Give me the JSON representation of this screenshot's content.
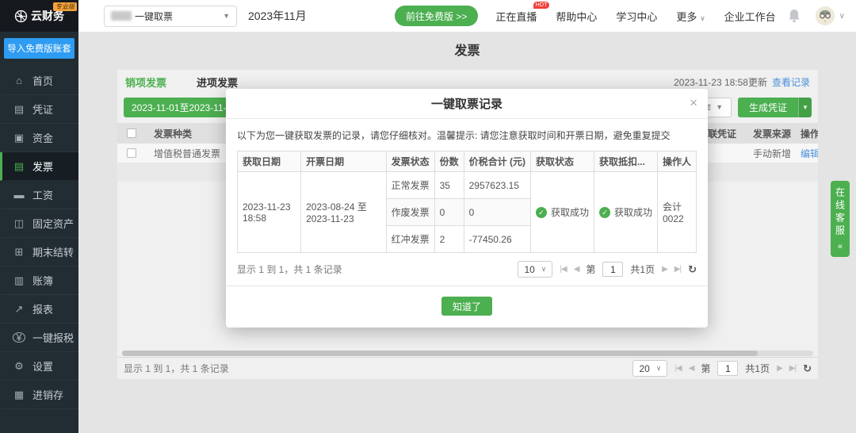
{
  "topbar": {
    "logo_text": "云财务",
    "logo_badge": "专业版",
    "module_select_value": "一键取票",
    "period": "2023年11月",
    "free_version_button": "前往免费版 >>",
    "live": "正在直播",
    "live_badge": "HOT",
    "help_center": "帮助中心",
    "learn_center": "学习中心",
    "more": "更多",
    "workbench": "企业工作台"
  },
  "sidebar": {
    "import_button": "导入免费版账套",
    "items": [
      {
        "icon": "⌂",
        "label": "首页"
      },
      {
        "icon": "▤",
        "label": "凭证"
      },
      {
        "icon": "▣",
        "label": "资金"
      },
      {
        "icon": "▤",
        "label": "发票"
      },
      {
        "icon": "▬",
        "label": "工资"
      },
      {
        "icon": "◫",
        "label": "固定资产"
      },
      {
        "icon": "⊞",
        "label": "期末结转"
      },
      {
        "icon": "▥",
        "label": "账簿"
      },
      {
        "icon": "↗",
        "label": "报表"
      },
      {
        "icon": "¥",
        "label": "一键报税"
      },
      {
        "icon": "⚙",
        "label": "设置"
      },
      {
        "icon": "▦",
        "label": "进销存"
      }
    ]
  },
  "page": {
    "title": "发票",
    "tab_sales": "销项发票",
    "tab_purchase": "进项发票",
    "update_time": "2023-11-23 18:58更新",
    "view_record_link": "查看记录",
    "date_range_button": "2023-11-01至2023-11-30",
    "batch_button": "批量操作",
    "generate_button": "生成凭证",
    "table": {
      "col_type": "发票种类",
      "col_voucher": "关联凭证",
      "col_source": "发票来源",
      "col_action": "操作",
      "row": {
        "type": "增值税普通发票",
        "source": "手动新增",
        "action": "编辑"
      }
    },
    "pagination": {
      "summary": "显示 1 到 1，共 1 条记录",
      "page_size": "20",
      "page_prefix": "第",
      "page": "1",
      "total_pages": "共1页"
    }
  },
  "modal": {
    "title": "一键取票记录",
    "description": "以下为您一键获取发票的记录，请您仔细核对。温馨提示: 请您注意获取时间和开票日期，避免重复提交",
    "table": {
      "col_fetch_date": "获取日期",
      "col_invoice_date": "开票日期",
      "col_invoice_status": "发票状态",
      "col_count": "份数",
      "col_amount": "价税合计 (元)",
      "col_fetch_status": "获取状态",
      "col_deduct_status": "获取抵扣...",
      "col_operator": "操作人",
      "record": {
        "fetch_date": "2023-11-23 18:58",
        "invoice_date_range": "2023-08-24 至 2023-11-23",
        "status_rows": [
          {
            "status": "正常发票",
            "count": "35",
            "amount": "2957623.15"
          },
          {
            "status": "作废发票",
            "count": "0",
            "amount": "0"
          },
          {
            "status": "红冲发票",
            "count": "2",
            "amount": "-77450.26"
          }
        ],
        "fetch_status": "获取成功",
        "deduct_status": "获取成功",
        "operator": "会计0022"
      }
    },
    "pagination": {
      "summary": "显示 1 到 1，共 1 条记录",
      "page_size": "10",
      "page_prefix": "第",
      "page": "1",
      "total_pages": "共1页"
    },
    "confirm_button": "知道了"
  },
  "floating": {
    "customer_service": "在线客服",
    "collapse_arrow": "«"
  },
  "icons": {
    "dropdown": "▼",
    "chevron_down": "∨",
    "close": "×",
    "check": "✓",
    "first_page": "|◀",
    "prev_page": "◀",
    "next_page": "▶",
    "last_page": "▶|",
    "refresh": "↻",
    "trend_up": "↗"
  },
  "colors": {
    "accent_green": "#4caf50",
    "link_blue": "#4a90d9",
    "import_blue": "#2e9cf2",
    "hot_red": "#f0413a",
    "badge_orange": "#f2a33c",
    "sidebar_dark": "#222c33"
  }
}
